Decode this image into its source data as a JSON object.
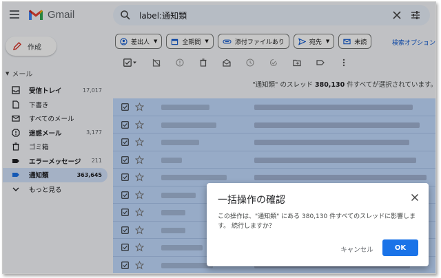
{
  "app": {
    "name": "Gmail"
  },
  "search": {
    "query": "label:通知類"
  },
  "sidebar": {
    "compose_label": "作成",
    "section_label": "メール",
    "items": [
      {
        "label": "受信トレイ",
        "count": "17,017",
        "icon": "inbox-icon",
        "bold": true
      },
      {
        "label": "下書き",
        "count": "",
        "icon": "draft-icon",
        "bold": false
      },
      {
        "label": "すべてのメール",
        "count": "",
        "icon": "all-mail-icon",
        "bold": false
      },
      {
        "label": "迷惑メール",
        "count": "3,177",
        "icon": "spam-icon",
        "bold": true
      },
      {
        "label": "ゴミ箱",
        "count": "",
        "icon": "trash-icon",
        "bold": false
      },
      {
        "label": "エラーメッセージ",
        "count": "211",
        "icon": "label-icon",
        "bold": true
      },
      {
        "label": "通知類",
        "count": "363,645",
        "icon": "label-icon",
        "bold": true,
        "active": true
      },
      {
        "label": "もっと見る",
        "count": "",
        "icon": "chevron-down-icon",
        "bold": false
      }
    ]
  },
  "filters": {
    "chips": [
      {
        "label": "差出人",
        "icon": "person-icon",
        "dropdown": true
      },
      {
        "label": "全期間",
        "icon": "calendar-icon",
        "dropdown": true
      },
      {
        "label": "添付ファイルあり",
        "icon": "attachment-icon",
        "dropdown": false
      },
      {
        "label": "宛先",
        "icon": "send-icon",
        "dropdown": true
      },
      {
        "label": "未読",
        "icon": "mail-icon",
        "dropdown": false
      }
    ],
    "advanced_label": "検索オプション"
  },
  "banner": {
    "prefix": "\"通知類\" のスレッド ",
    "count": "380,130",
    "suffix": " 件すべてが選択されています。"
  },
  "dialog": {
    "title": "一括操作の確認",
    "body": "この操作は、\"通知類\" にある 380,130 件すべてのスレッドに影響します。 続行しますか？",
    "cancel_label": "キャンセル",
    "ok_label": "OK"
  },
  "colors": {
    "accent": "#1a73e8",
    "selected_row": "#c2dbff",
    "active_nav": "#d3e3fd"
  }
}
